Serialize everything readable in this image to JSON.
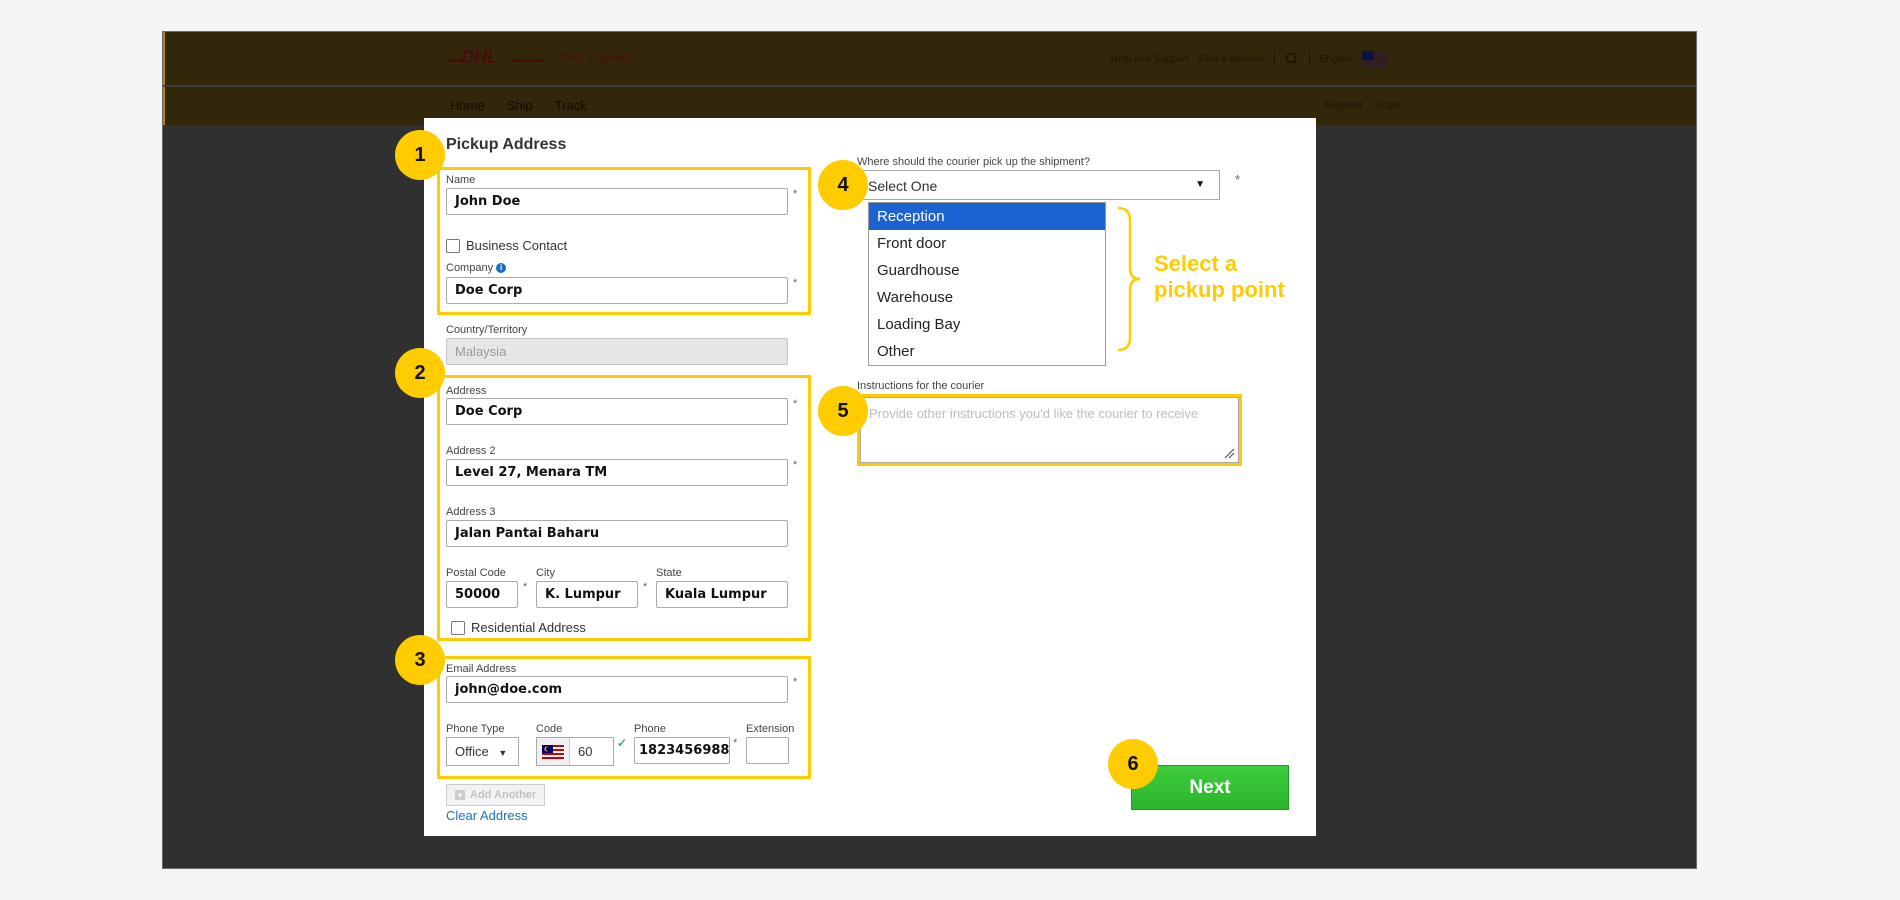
{
  "header": {
    "brand": "DHL Express",
    "top_links": [
      "Help and Support",
      "Find a location"
    ],
    "language": "English",
    "nav": [
      "Home",
      "Ship",
      "Track"
    ],
    "account_links": [
      "Register",
      "Login"
    ]
  },
  "form": {
    "title": "Pickup Address",
    "name": {
      "label": "Name",
      "value": "John Doe"
    },
    "business_contact": {
      "label": "Business Contact",
      "checked": false
    },
    "company": {
      "label": "Company",
      "value": "Doe Corp"
    },
    "country": {
      "label": "Country/Territory",
      "value": "Malaysia"
    },
    "address1": {
      "label": "Address",
      "value": "Doe Corp"
    },
    "address2": {
      "label": "Address 2",
      "value": "Level 27, Menara TM"
    },
    "address3": {
      "label": "Address 3",
      "value": "Jalan Pantai Baharu"
    },
    "postal": {
      "label": "Postal Code",
      "value": "50000"
    },
    "city": {
      "label": "City",
      "value": "K. Lumpur"
    },
    "state": {
      "label": "State",
      "value": "Kuala Lumpur"
    },
    "residential": {
      "label": "Residential Address",
      "checked": false
    },
    "email": {
      "label": "Email Address",
      "value": "john@doe.com"
    },
    "phone_type": {
      "label": "Phone Type",
      "value": "Office"
    },
    "code": {
      "label": "Code",
      "value": "60"
    },
    "phone": {
      "label": "Phone",
      "value": "1823456988"
    },
    "extension": {
      "label": "Extension",
      "value": ""
    },
    "add_another": "Add Another",
    "clear_address": "Clear Address",
    "required_mark": "*"
  },
  "pickup": {
    "label": "Where should the courier pick up the shipment?",
    "selected": "Select One",
    "options": [
      "Reception",
      "Front door",
      "Guardhouse",
      "Warehouse",
      "Loading Bay",
      "Other"
    ],
    "highlighted_option": "Reception"
  },
  "instructions": {
    "label": "Instructions for the courier",
    "placeholder": "Provide other instructions you'd like the courier to receive"
  },
  "annotation": {
    "line1": "Select a",
    "line2": "pickup point"
  },
  "badges": [
    "1",
    "2",
    "3",
    "4",
    "5",
    "6"
  ],
  "next_label": "Next",
  "colors": {
    "highlight": "#ffcc00",
    "next": "#33c233",
    "selected_option": "#1b63d2",
    "link": "#1a6fc9"
  }
}
